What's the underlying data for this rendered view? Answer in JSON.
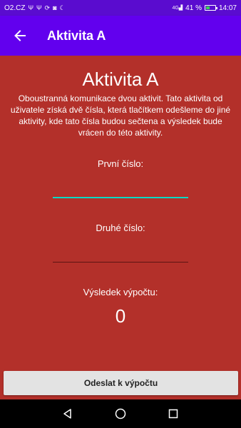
{
  "status_bar": {
    "carrier": "O2.CZ",
    "left_icons": [
      "usb-icon",
      "usb-icon",
      "sync-icon",
      "notification-icon",
      "moon-icon"
    ],
    "signal_tag": "4G",
    "battery_percent": "41 %",
    "battery_level": 0.41,
    "time": "14:07",
    "background_color": "#5a0ccf"
  },
  "app_bar": {
    "title": "Aktivita A",
    "back_icon": "arrow-left-icon",
    "background_color": "#6200ee"
  },
  "main": {
    "background_color": "#b3302a",
    "heading": "Aktivita A",
    "description": "Oboustranná komunikace dvou aktivit. Tato aktivita od uživatele získá dvě čísla, která tlačítkem odešleme do jiné aktivity, kde tato čísla budou sečtena a výsledek bude vrácen do této aktivity.",
    "first_label": "První číslo:",
    "first_value": "",
    "second_label": "Druhé číslo:",
    "second_value": "",
    "result_label": "Výsledek výpočtu:",
    "result_value": "0",
    "submit_label": "Odeslat k výpočtu",
    "accent_color": "#03dac5"
  },
  "nav_bar": {
    "icons": [
      "back-triangle-icon",
      "home-circle-icon",
      "recents-square-icon"
    ]
  }
}
